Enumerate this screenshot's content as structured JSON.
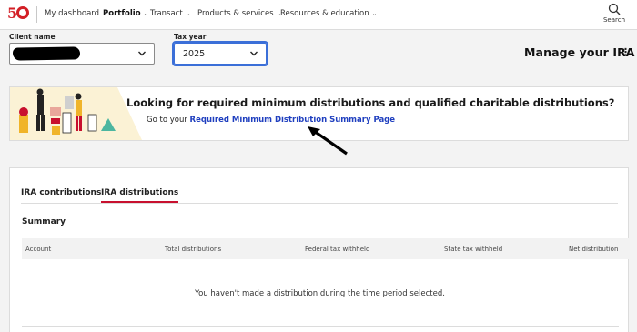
{
  "nav": {
    "logo": "50",
    "items": [
      {
        "label": "My dashboard",
        "dropdown": false,
        "active": false
      },
      {
        "label": "Portfolio",
        "dropdown": true,
        "active": true
      },
      {
        "label": "Transact",
        "dropdown": true,
        "active": false
      },
      {
        "label": "Products & services",
        "dropdown": true,
        "active": false
      },
      {
        "label": "Resources & education",
        "dropdown": true,
        "active": false
      }
    ],
    "search_label": "Search"
  },
  "client": {
    "label": "Client name",
    "value": ""
  },
  "tax_year": {
    "label": "Tax year",
    "value": "2025"
  },
  "page_title": "Manage your IRA",
  "kebab": "⋮",
  "banner": {
    "title": "Looking for required minimum distributions and qualified charitable distributions?",
    "prefix": "Go to your",
    "link": "Required Minimum Distribution Summary Page"
  },
  "tabs": [
    {
      "label": "IRA contributions",
      "active": false
    },
    {
      "label": "IRA distributions",
      "active": true
    }
  ],
  "summary_heading": "Summary",
  "table": {
    "columns": [
      "Account",
      "Total distributions",
      "Federal tax withheld",
      "State tax withheld",
      "Net distribution"
    ],
    "empty_message": "You haven't made a distribution during the time period selected."
  },
  "colors": {
    "brand_red": "#d31f26",
    "link_blue": "#1f3fbf",
    "tab_underline": "#c8102e",
    "focus_blue": "#3b6fd8"
  }
}
